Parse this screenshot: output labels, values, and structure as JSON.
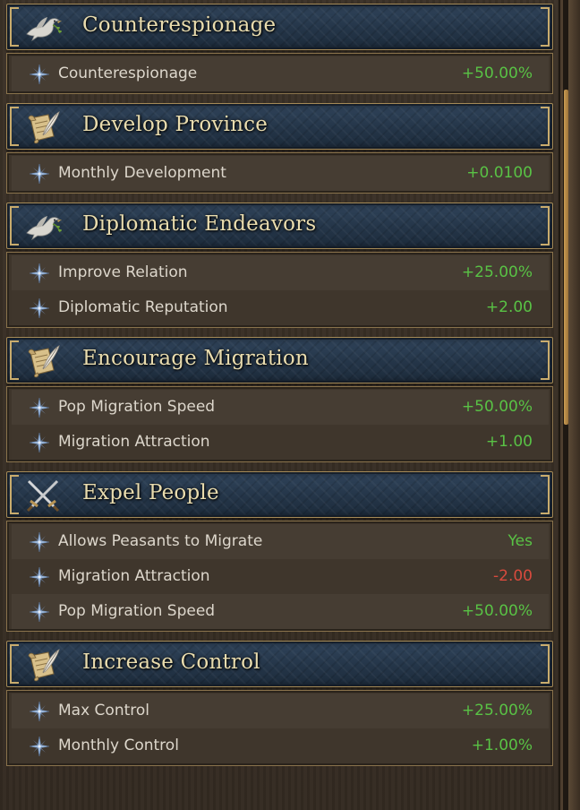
{
  "colors": {
    "positive": "#59c245",
    "negative": "#d94a3d",
    "title": "#e9dcae",
    "label": "#ddd7cc"
  },
  "sections": [
    {
      "icon": "dove-icon",
      "title": "Counterespionage",
      "rows": [
        {
          "icon": "compass-star-icon",
          "label": "Counterespionage",
          "value": "+50.00%",
          "sign": "positive"
        }
      ]
    },
    {
      "icon": "scroll-quill-icon",
      "title": "Develop Province",
      "rows": [
        {
          "icon": "compass-star-icon",
          "label": "Monthly Development",
          "value": "+0.0100",
          "sign": "positive"
        }
      ]
    },
    {
      "icon": "dove-icon",
      "title": "Diplomatic Endeavors",
      "rows": [
        {
          "icon": "compass-star-icon",
          "label": "Improve Relation",
          "value": "+25.00%",
          "sign": "positive"
        },
        {
          "icon": "compass-star-icon",
          "label": "Diplomatic Reputation",
          "value": "+2.00",
          "sign": "positive"
        }
      ]
    },
    {
      "icon": "scroll-quill-icon",
      "title": "Encourage Migration",
      "rows": [
        {
          "icon": "compass-star-icon",
          "label": "Pop Migration Speed",
          "value": "+50.00%",
          "sign": "positive"
        },
        {
          "icon": "compass-star-icon",
          "label": "Migration Attraction",
          "value": "+1.00",
          "sign": "positive"
        }
      ]
    },
    {
      "icon": "crossed-swords-icon",
      "title": "Expel People",
      "rows": [
        {
          "icon": "compass-star-icon",
          "label": "Allows Peasants to Migrate",
          "value": "Yes",
          "sign": "positive"
        },
        {
          "icon": "compass-star-icon",
          "label": "Migration Attraction",
          "value": "-2.00",
          "sign": "negative"
        },
        {
          "icon": "compass-star-icon",
          "label": "Pop Migration Speed",
          "value": "+50.00%",
          "sign": "positive"
        }
      ]
    },
    {
      "icon": "scroll-quill-icon",
      "title": "Increase Control",
      "rows": [
        {
          "icon": "compass-star-icon",
          "label": "Max Control",
          "value": "+25.00%",
          "sign": "positive"
        },
        {
          "icon": "compass-star-icon",
          "label": "Monthly Control",
          "value": "+1.00%",
          "sign": "positive"
        }
      ]
    }
  ]
}
